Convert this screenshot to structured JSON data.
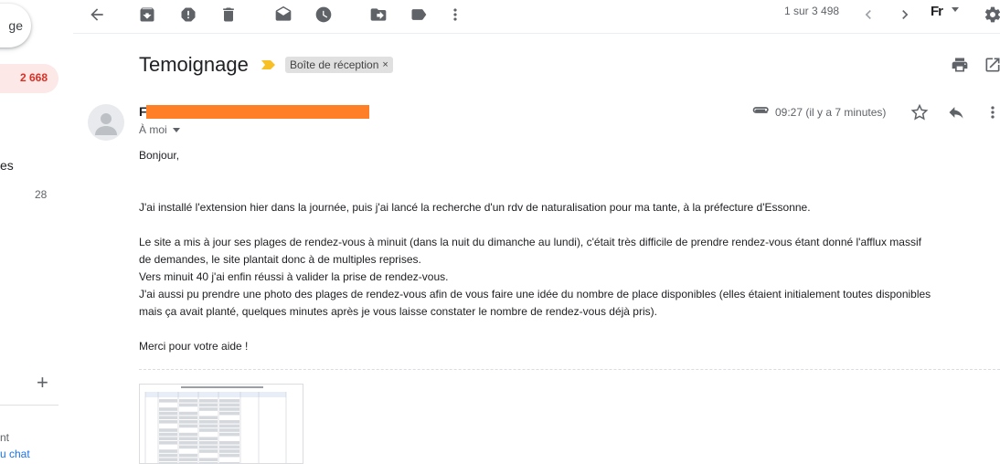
{
  "sidebar": {
    "compose_label": "ge",
    "inbox_count": "2 668",
    "partial_label": "es",
    "partial_count": "28",
    "add_symbol": "+",
    "footer_line1": "nt",
    "footer_line2": "u chat"
  },
  "toolbar": {
    "pager": "1 sur 3 498",
    "language": "Fr",
    "icons": [
      "back-arrow-icon",
      "archive-icon",
      "report-spam-icon",
      "delete-icon",
      "mark-unread-icon",
      "snooze-icon",
      "move-to-icon",
      "label-icon",
      "more-vert-icon",
      "chevron-left-icon",
      "chevron-right-icon",
      "settings-icon"
    ]
  },
  "message": {
    "subject": "Temoignage",
    "label_chip": "Boîte de réception",
    "label_chip_remove": "×",
    "sender_initial": "F",
    "to_line": "À moi",
    "time": "09:27 (il y a 7 minutes)",
    "body": [
      "Bonjour,",
      "J'ai installé l'extension hier dans la journée, puis j'ai lancé la recherche d'un rdv de naturalisation pour ma tante, à la préfecture d'Essonne.",
      "Le site a mis à jour ses plages de rendez-vous à minuit (dans la nuit du dimanche au lundi), c'était très difficile de prendre rendez-vous étant donné l'afflux massif",
      "de demandes, le site plantait donc à de multiples reprises.",
      "Vers minuit 40 j'ai enfin réussi à valider la prise de rendez-vous.",
      "J'ai aussi pu prendre une photo des plages de rendez-vous afin de vous faire une idée du nombre de place disponibles (elles étaient initialement toutes disponibles",
      "mais ça avait planté, quelques minutes après je vous laisse constater le nombre de rendez-vous déjà pris).",
      "Merci pour votre aide !"
    ]
  },
  "colors": {
    "accent_red": "#d93025",
    "inbox_bg": "#fce8e6",
    "label_arrow": "#f6c026",
    "redaction": "#ff7f27",
    "icon_gray": "#5f6368"
  }
}
